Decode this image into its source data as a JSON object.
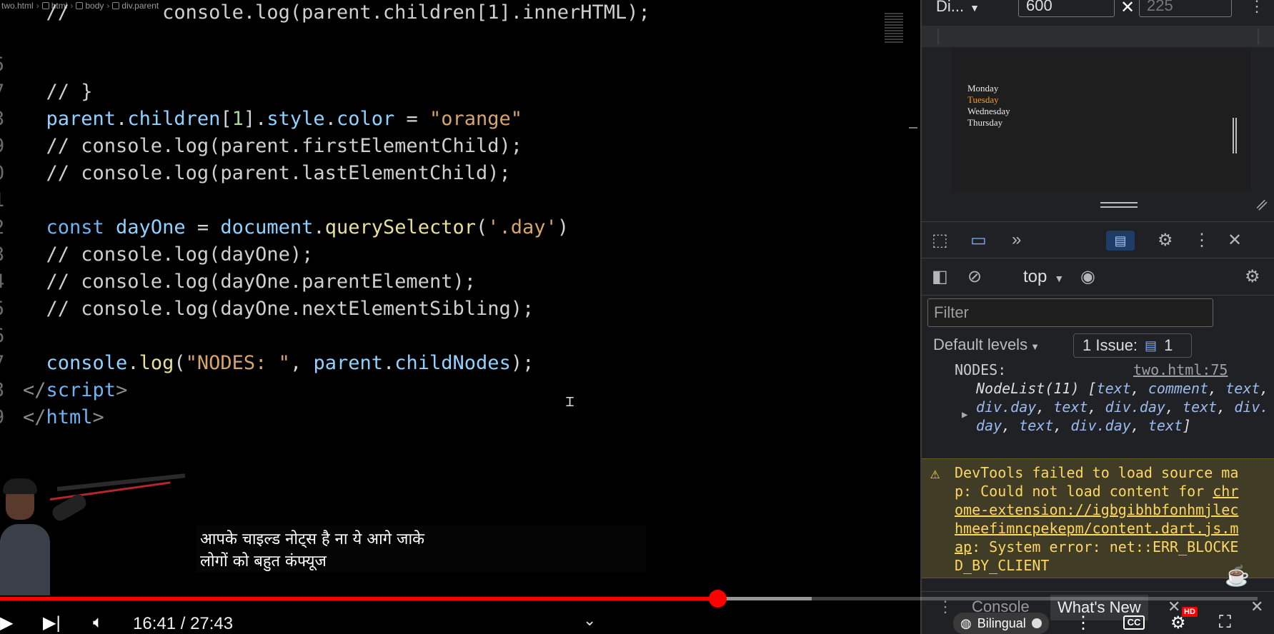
{
  "editor": {
    "breadcrumb": [
      "two.html",
      "html",
      "body",
      "div.parent"
    ],
    "code_lines": [
      {
        "ln": "",
        "parts": [
          [
            "c-comment",
            "  //        console.log(parent.children[1].innerHTML);"
          ]
        ]
      },
      {
        "ln": "5",
        "parts": [
          [
            "c-plain",
            ""
          ]
        ]
      },
      {
        "ln": "7",
        "parts": [
          [
            "c-comment",
            "  // }"
          ]
        ]
      },
      {
        "ln": "3",
        "parts": [
          [
            "c-var",
            "  parent"
          ],
          [
            "c-plain",
            "."
          ],
          [
            "c-prop",
            "children"
          ],
          [
            "c-plain",
            "["
          ],
          [
            "c-num",
            "1"
          ],
          [
            "c-plain",
            "]."
          ],
          [
            "c-prop",
            "style"
          ],
          [
            "c-plain",
            "."
          ],
          [
            "c-prop",
            "color"
          ],
          [
            "c-plain",
            " = "
          ],
          [
            "c-str",
            "\"orange\""
          ]
        ]
      },
      {
        "ln": "9",
        "parts": [
          [
            "c-comment",
            "  // console.log(parent.firstElementChild);"
          ]
        ]
      },
      {
        "ln": "0",
        "parts": [
          [
            "c-comment",
            "  // console.log(parent.lastElementChild);"
          ]
        ]
      },
      {
        "ln": "1",
        "parts": [
          [
            "c-plain",
            ""
          ]
        ]
      },
      {
        "ln": "2",
        "parts": [
          [
            "c-kw",
            "  const "
          ],
          [
            "c-var",
            "dayOne"
          ],
          [
            "c-plain",
            " = "
          ],
          [
            "c-var",
            "document"
          ],
          [
            "c-plain",
            "."
          ],
          [
            "c-fn",
            "querySelector"
          ],
          [
            "c-plain",
            "("
          ],
          [
            "c-str",
            "'.day'"
          ],
          [
            "c-plain",
            ")"
          ]
        ]
      },
      {
        "ln": "3",
        "parts": [
          [
            "c-comment",
            "  // console.log(dayOne);"
          ]
        ]
      },
      {
        "ln": "4",
        "parts": [
          [
            "c-comment",
            "  // console.log(dayOne.parentElement);"
          ]
        ]
      },
      {
        "ln": "5",
        "parts": [
          [
            "c-comment",
            "  // console.log(dayOne.nextElementSibling);"
          ]
        ]
      },
      {
        "ln": "6",
        "parts": [
          [
            "c-plain",
            ""
          ]
        ]
      },
      {
        "ln": "7",
        "parts": [
          [
            "c-var",
            "  console"
          ],
          [
            "c-plain",
            "."
          ],
          [
            "c-fn",
            "log"
          ],
          [
            "c-plain",
            "("
          ],
          [
            "c-str",
            "\"NODES: \""
          ],
          [
            "c-plain",
            ", "
          ],
          [
            "c-var",
            "parent"
          ],
          [
            "c-plain",
            "."
          ],
          [
            "c-prop",
            "childNodes"
          ],
          [
            "c-plain",
            ");"
          ]
        ]
      },
      {
        "ln": "3",
        "parts": [
          [
            "c-tag",
            "</"
          ],
          [
            "c-kw",
            "script"
          ],
          [
            "c-tag",
            ">"
          ]
        ]
      },
      {
        "ln": "9",
        "parts": [
          [
            "c-tag",
            "</"
          ],
          [
            "c-kw",
            "html"
          ],
          [
            "c-tag",
            ">"
          ]
        ]
      }
    ]
  },
  "devtools": {
    "dimension_select": "Di...",
    "width": "600",
    "height_placeholder": "225",
    "close_x": "✕",
    "preview_days": [
      {
        "label": "Monday",
        "color": "#eaeaea"
      },
      {
        "label": "Tuesday",
        "color": "#f29b2c"
      },
      {
        "label": "Wednesday",
        "color": "#eaeaea"
      },
      {
        "label": "Thursday",
        "color": "#eaeaea"
      }
    ],
    "context": "top",
    "filter_placeholder": "Filter",
    "levels": "Default levels",
    "issues_label": "1 Issue:",
    "issues_count": "1",
    "log_head": "NODES:",
    "log_source": "two.html:75",
    "nodelist_prefix": "NodeList(11) [",
    "nodelist_items": [
      "text",
      "comment",
      "text",
      "div.day",
      "text",
      "div.day",
      "text",
      "div.day",
      "text",
      "div.day",
      "text"
    ],
    "nodelist_suffix": "]",
    "warning_pre": "DevTools failed to load source map: Could not load content for ",
    "warning_link": "chrome-extension://igbgibhbfonhmjlechmeefimncpekepm/content.dart.js.map",
    "warning_post": ": System error: net::ERR_BLOCKED_BY_CLIENT",
    "tabs": {
      "console": "Console",
      "whats_new": "What's New"
    }
  },
  "video": {
    "subtitle_line1": "आपके चाइल्ड नोट्स है ना ये आगे जाके",
    "subtitle_line2": "लोगों को बहुत कंफ्यूज",
    "time": "16:41 / 27:43",
    "progress": 0.5706,
    "buffered": 0.577,
    "bilingual": "Bilingual",
    "cc": "CC",
    "hd": "HD",
    "accent": "#ff0000"
  }
}
